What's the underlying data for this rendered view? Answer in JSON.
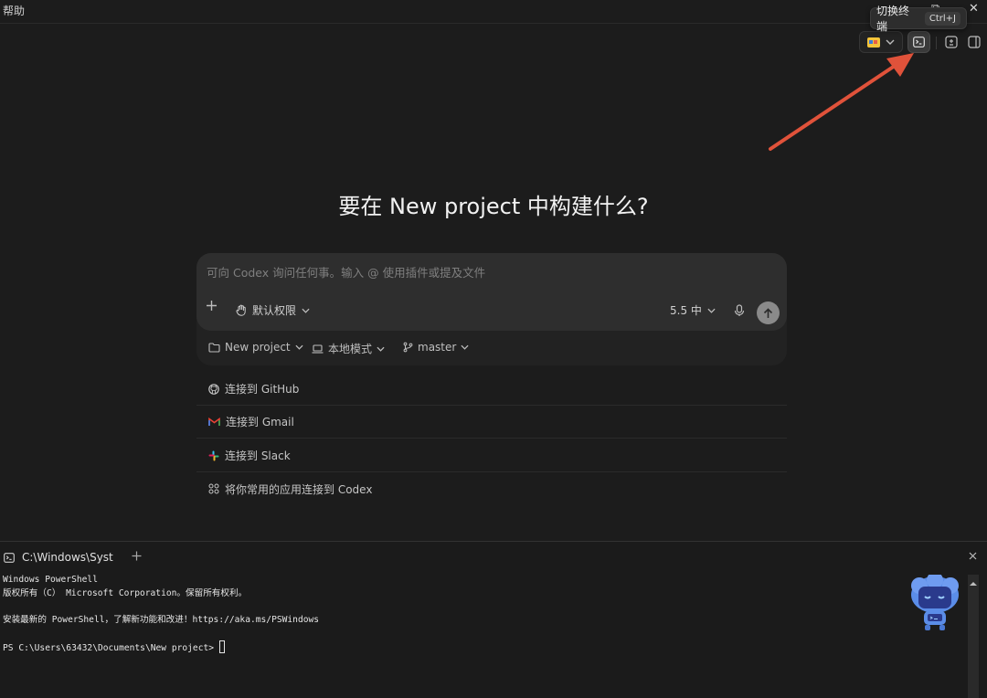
{
  "menu": {
    "help": "帮助"
  },
  "window": {
    "minimize": "—",
    "restore": "⧉",
    "close": "✕"
  },
  "tooltip": {
    "label": "切换终端",
    "shortcut": "Ctrl+J"
  },
  "colors": {
    "accent_arrow": "#e0523a",
    "send_button": "#8a8a8a"
  },
  "hero": {
    "title": "要在 New project 中构建什么?"
  },
  "composer": {
    "placeholder": "可向 Codex 询问任何事。输入 @ 使用插件或提及文件",
    "permission": "默认权限",
    "model": "5.5 中"
  },
  "context": {
    "project": "New project",
    "mode": "本地模式",
    "branch": "master"
  },
  "suggestions": [
    {
      "label": "连接到 GitHub",
      "icon": "github-icon"
    },
    {
      "label": "连接到 Gmail",
      "icon": "gmail-icon"
    },
    {
      "label": "连接到 Slack",
      "icon": "slack-icon"
    },
    {
      "label": "将你常用的应用连接到 Codex",
      "icon": "apps-grid-icon"
    }
  ],
  "terminal": {
    "tab_title": "C:\\Windows\\Syster",
    "lines": [
      "Windows PowerShell",
      "版权所有（C） Microsoft Corporation。保留所有权利。",
      "",
      "安装最新的 PowerShell，了解新功能和改进！https://aka.ms/PSWindows",
      ""
    ],
    "prompt": "PS C:\\Users\\63432\\Documents\\New project> "
  }
}
